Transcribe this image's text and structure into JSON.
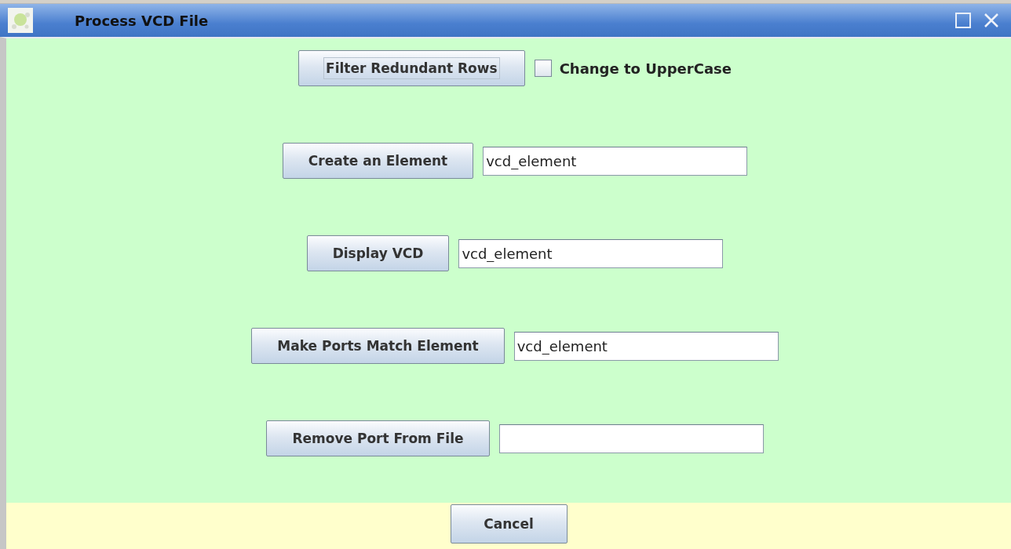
{
  "window": {
    "title": "Process VCD File"
  },
  "rows": [
    {
      "kind": "checkbox",
      "button": {
        "label": "Filter Redundant Rows",
        "focused": true
      },
      "checkbox": {
        "label": "Change to UpperCase",
        "checked": false
      }
    },
    {
      "kind": "field",
      "button": {
        "label": "Create an Element",
        "focused": false
      },
      "field": {
        "value": "vcd_element"
      }
    },
    {
      "kind": "field",
      "button": {
        "label": "Display VCD",
        "focused": false
      },
      "field": {
        "value": "vcd_element"
      }
    },
    {
      "kind": "field",
      "button": {
        "label": "Make Ports Match Element",
        "focused": false
      },
      "field": {
        "value": "vcd_element"
      }
    },
    {
      "kind": "field",
      "button": {
        "label": "Remove Port From File",
        "focused": false
      },
      "field": {}
    }
  ],
  "footer": {
    "buttons": [
      "Cancel"
    ]
  }
}
